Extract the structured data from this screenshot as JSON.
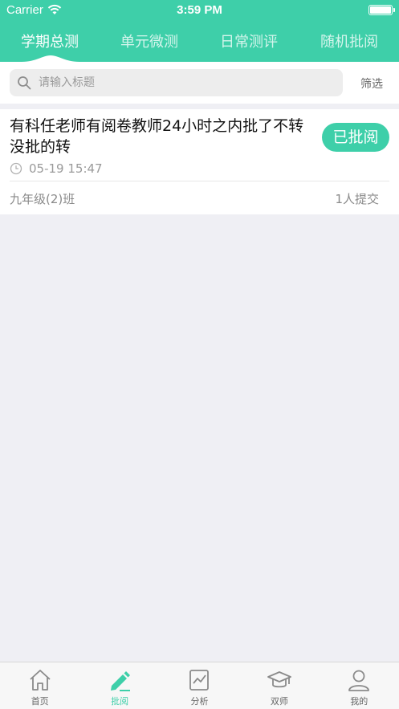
{
  "status_bar": {
    "carrier": "Carrier",
    "time": "3:59 PM"
  },
  "top_tabs": [
    {
      "label": "学期总测",
      "active": true
    },
    {
      "label": "单元微测",
      "active": false
    },
    {
      "label": "日常测评",
      "active": false
    },
    {
      "label": "随机批阅",
      "active": false
    }
  ],
  "search": {
    "placeholder": "请输入标题",
    "value": "",
    "filter_label": "筛选"
  },
  "assignments": [
    {
      "title": "有科任老师有阅卷教师24小时之内批了不转没批的转",
      "status": "已批阅",
      "time": "05-19 15:47",
      "class_name": "九年级(2)班",
      "submit_count": "1人提交"
    }
  ],
  "bottom_nav": [
    {
      "label": "首页",
      "icon": "home-icon",
      "active": false
    },
    {
      "label": "批阅",
      "icon": "pen-icon",
      "active": true
    },
    {
      "label": "分析",
      "icon": "analysis-icon",
      "active": false
    },
    {
      "label": "双师",
      "icon": "graduation-cap-icon",
      "active": false
    },
    {
      "label": "我的",
      "icon": "user-icon",
      "active": false
    }
  ],
  "colors": {
    "accent": "#3ecfa9",
    "background": "#efeff4",
    "inactive_icon": "#8a8a8a"
  }
}
